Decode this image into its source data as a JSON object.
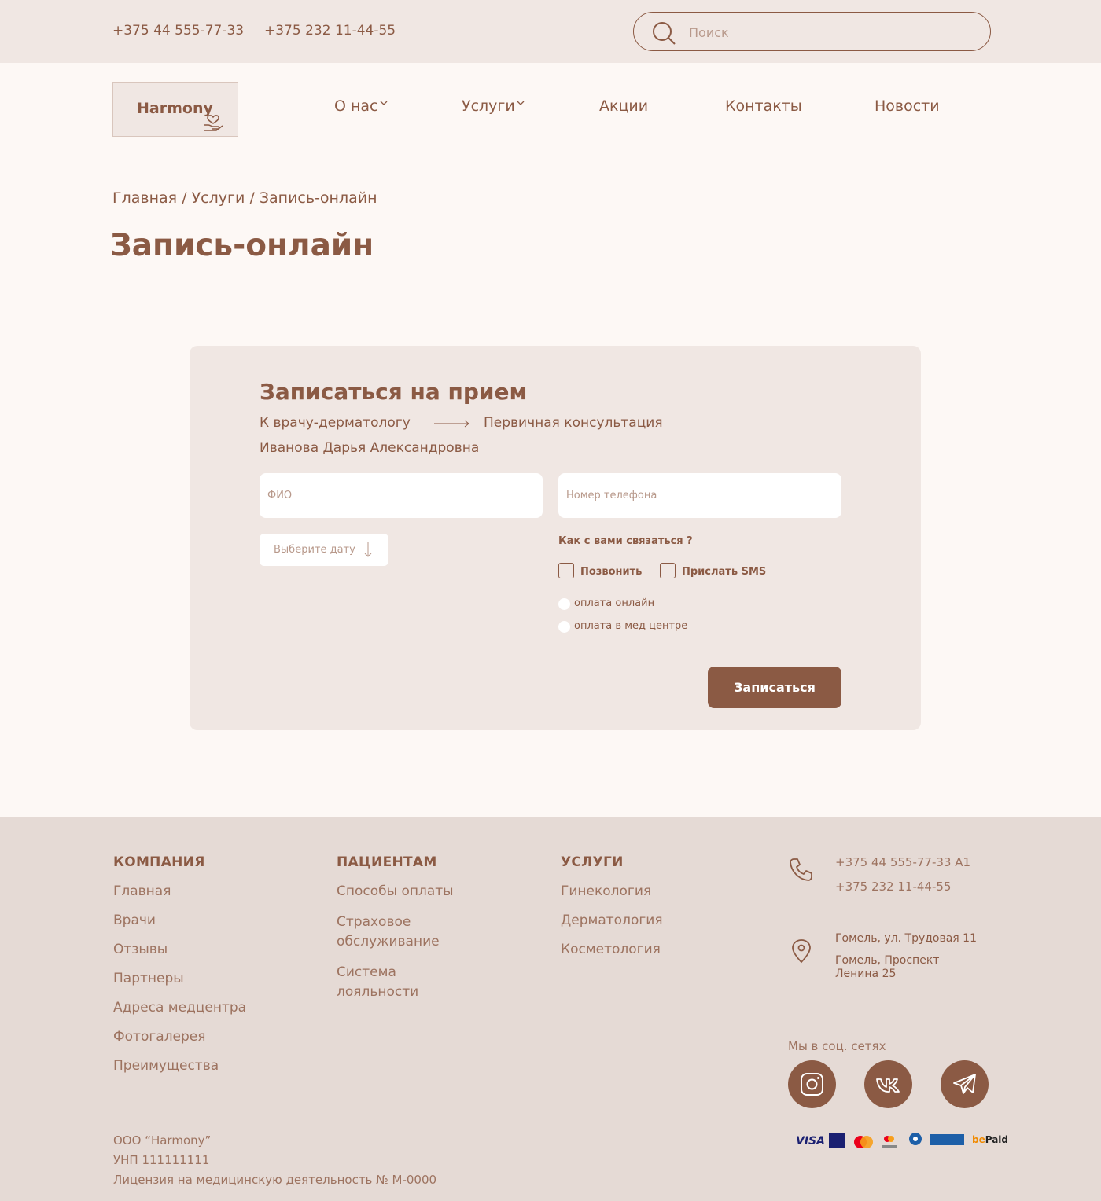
{
  "topbar": {
    "phone1": "+375 44 555-77-33",
    "phone2": "+375 232 11-44-55",
    "search_placeholder": "Поиск"
  },
  "header": {
    "logo_text": "Harmony",
    "nav": [
      {
        "label": "О нас"
      },
      {
        "label": "Услуги"
      },
      {
        "label": "Акции"
      },
      {
        "label": "Контакты"
      },
      {
        "label": "Новости"
      }
    ]
  },
  "breadcrumbs": {
    "home": "Главная",
    "services": "Услуги",
    "current": "Запись-онлайн",
    "sep": "/"
  },
  "page_title": "Запись-онлайн",
  "form": {
    "title": "Записаться на прием",
    "service_from": "К врачу-дерматологу",
    "service_to": "Первичная консультация",
    "doctor": "Иванова Дарья Александровна",
    "name_placeholder": "ФИО",
    "phone_placeholder": "Номер телефона",
    "date_label": "Выберите дату",
    "contact_question": "Как с вами связаться ?",
    "option_call": "Позвонить",
    "option_sms": "Прислать SMS",
    "pay_online": "оплата онлайн",
    "pay_center": "оплата в мед центре",
    "submit": "Записаться"
  },
  "footer": {
    "company_head": "КОМПАНИЯ",
    "company_links": [
      "Главная",
      "Врачи",
      "Отзывы",
      "Партнеры",
      "Адреса медцентра",
      "Фотогалерея",
      "Преимущества"
    ],
    "patients_head": "ПАЦИЕНТАМ",
    "patients_links": [
      "Способы оплаты",
      "Страховое обслуживание",
      "Система лояльности"
    ],
    "services_head": "УСЛУГИ",
    "services_links": [
      "Гинекология",
      "Дерматология",
      "Косметология"
    ],
    "phone1": "+375 44 555-77-33 А1",
    "phone2": "+375 232 11-44-55",
    "address1": "Гомель, ул. Трудовая 11",
    "address2": "Гомель, Проспект Ленина 25",
    "social_label": "Мы в соц. сетях",
    "org": "ООО “Harmony”",
    "unp": "УНП 111111111",
    "license": "Лицензия на медицинскую деятельность № М-0000",
    "payment_logos": {
      "visa": "VISA",
      "bepaid_be": "be",
      "bepaid_paid": "Paid"
    }
  },
  "colors": {
    "brand": "#8b5a44",
    "topbar_bg": "#f0e7e3",
    "page_bg": "#fdf8f5",
    "footer_bg": "#e5dad5"
  }
}
